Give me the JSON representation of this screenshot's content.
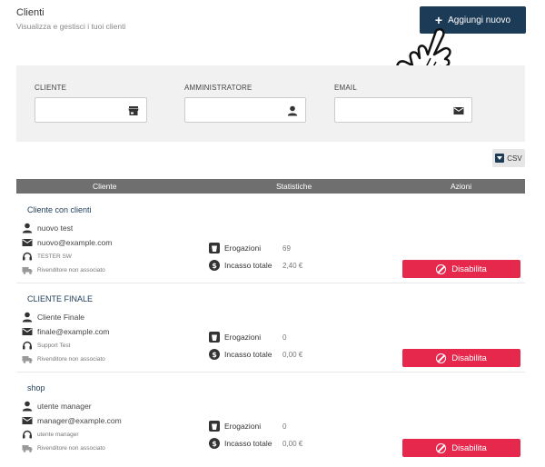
{
  "header": {
    "title": "Clienti",
    "subtitle": "Visualizza e gestisci i tuoi clienti"
  },
  "add_button": {
    "label": "Aggiungi nuovo"
  },
  "filters": [
    {
      "label": "CLIENTE",
      "icon": "store-icon"
    },
    {
      "label": "AMMINISTRATORE",
      "icon": "person-icon"
    },
    {
      "label": "EMAIL",
      "icon": "mail-icon"
    }
  ],
  "csv_button": {
    "label": "CSV"
  },
  "table": {
    "columns": [
      "Cliente",
      "Statistiche",
      "Azioni"
    ],
    "rows": [
      {
        "title": "Cliente con clienti",
        "admin": "nuovo test",
        "email": "nuovo@example.com",
        "support": "TESTER SW",
        "reseller": "Rivenditore non associato",
        "erogazioni_label": "Erogazioni",
        "erogazioni": "69",
        "incasso_label": "Incasso totale",
        "incasso": "2,40 €",
        "action": "Disabilita"
      },
      {
        "title": "CLIENTE FINALE",
        "admin": "Cliente Finale",
        "email": "finale@example.com",
        "support": "Support Test",
        "reseller": "Rivenditore non associato",
        "erogazioni_label": "Erogazioni",
        "erogazioni": "0",
        "incasso_label": "Incasso totale",
        "incasso": "0,00 €",
        "action": "Disabilita"
      },
      {
        "title": "shop",
        "admin": "utente manager",
        "email": "manager@example.com",
        "support": "utente manager",
        "reseller": "Rivenditore non associato",
        "erogazioni_label": "Erogazioni",
        "erogazioni": "0",
        "incasso_label": "Incasso totale",
        "incasso": "0,00 €",
        "action": "Disabilita"
      }
    ]
  },
  "colors": {
    "primary": "#1c3b57",
    "danger": "#e6284c",
    "table_head": "#6f6f6f",
    "filter_bg": "#f1f1f1"
  }
}
